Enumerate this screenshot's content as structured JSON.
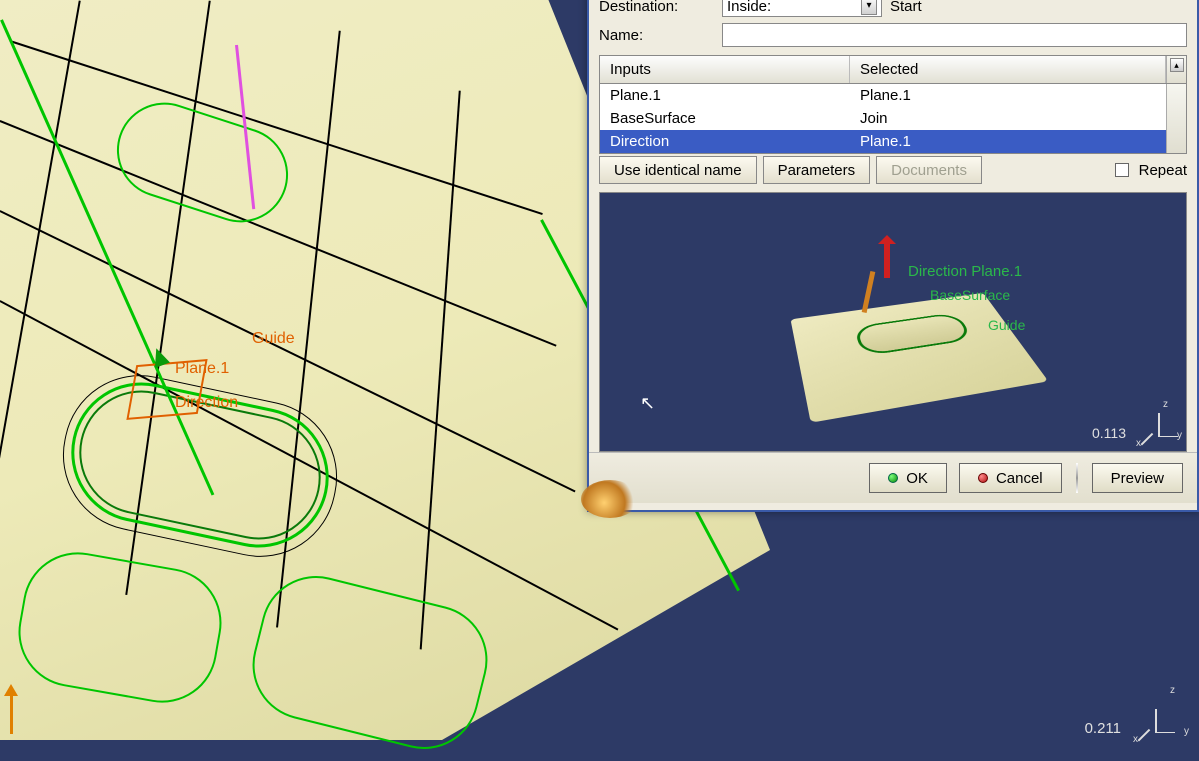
{
  "dialog": {
    "destination_label": "Destination:",
    "destination_value": "Inside:",
    "destination_suffix": "Start",
    "name_label": "Name:",
    "name_value": "",
    "table": {
      "col_inputs": "Inputs",
      "col_selected": "Selected",
      "rows": [
        {
          "input": "Plane.1",
          "selected": "Plane.1"
        },
        {
          "input": "BaseSurface",
          "selected": "Join"
        },
        {
          "input": "Direction",
          "selected": "Plane.1"
        }
      ]
    },
    "btn_use_identical": "Use identical name",
    "btn_parameters": "Parameters",
    "btn_documents": "Documents",
    "repeat_label": "Repeat",
    "preview": {
      "lbl_direction": "Direction",
      "lbl_plane": "Plane.1",
      "lbl_basesurface": "BaseSurface",
      "lbl_guide": "Guide",
      "size": "0.113",
      "ax_x": "x",
      "ax_y": "y",
      "ax_z": "z"
    },
    "footer": {
      "ok": "OK",
      "cancel": "Cancel",
      "preview": "Preview"
    }
  },
  "canvas": {
    "lbl_guide": "Guide",
    "lbl_plane": "Plane.1",
    "lbl_direction": "Direction",
    "size": "0.211",
    "ax_x": "x",
    "ax_y": "y",
    "ax_z": "z"
  }
}
